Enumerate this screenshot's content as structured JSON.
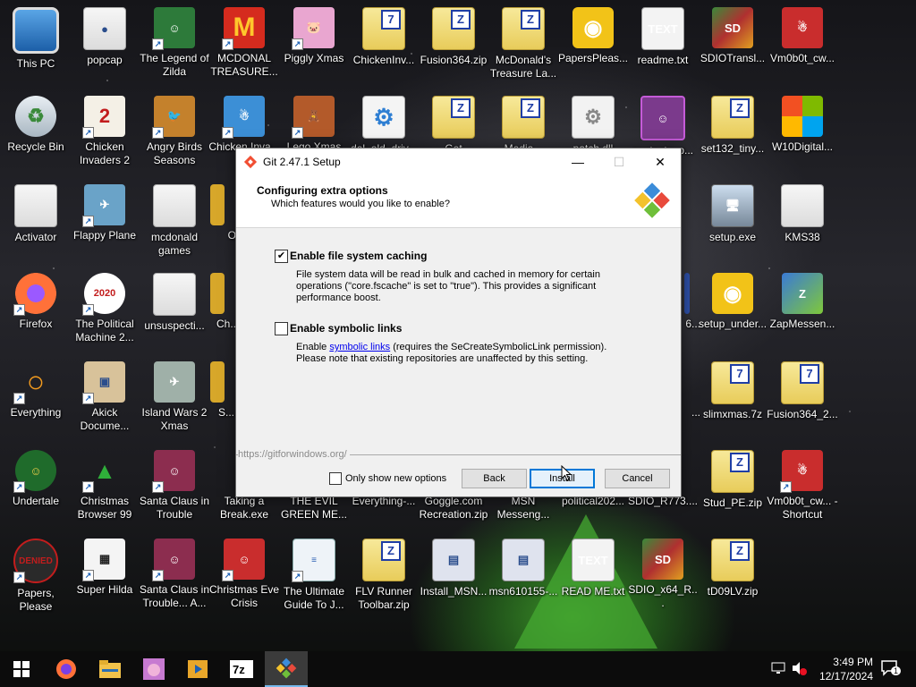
{
  "desktop": {
    "icons": [
      {
        "id": "i0",
        "label": "This PC"
      },
      {
        "id": "i1",
        "label": "popcap"
      },
      {
        "id": "i2",
        "label": "The Legend of Zilda"
      },
      {
        "id": "i3",
        "label": "MCDONAL TREASURE..."
      },
      {
        "id": "i4",
        "label": "Piggly Xmas"
      },
      {
        "id": "i5",
        "label": "ChickenInv..."
      },
      {
        "id": "i6",
        "label": "Fusion364.zip"
      },
      {
        "id": "i7",
        "label": "McDonald's Treasure La..."
      },
      {
        "id": "i8",
        "label": "PapersPleas..."
      },
      {
        "id": "i9",
        "label": "readme.txt"
      },
      {
        "id": "i10",
        "label": "SDIOTransl..."
      },
      {
        "id": "i11",
        "label": "Vm0b0t_cw..."
      },
      {
        "id": "i12",
        "label": "Recycle Bin"
      },
      {
        "id": "i13",
        "label": "Chicken Invaders 2"
      },
      {
        "id": "i14",
        "label": "Angry Birds Seasons"
      },
      {
        "id": "i15",
        "label": "Chicken Inva..."
      },
      {
        "id": "i16",
        "label": "Lego Xmas"
      },
      {
        "id": "i17",
        "label": "del_old_driv..."
      },
      {
        "id": "i18",
        "label": "Get Directions..."
      },
      {
        "id": "i19",
        "label": "Media..."
      },
      {
        "id": "i20",
        "label": "patch.dll"
      },
      {
        "id": "i21",
        "label": "contactsup..."
      },
      {
        "id": "i22",
        "label": "set132_tiny..."
      },
      {
        "id": "i23",
        "label": "W10Digital..."
      },
      {
        "id": "i24",
        "label": "Activator"
      },
      {
        "id": "i25",
        "label": "Flappy Plane"
      },
      {
        "id": "i26",
        "label": "mcdonald games"
      },
      {
        "id": "i27",
        "label": "Orna..."
      },
      {
        "id": "i28",
        "label": "setup.exe"
      },
      {
        "id": "i29",
        "label": "KMS38"
      },
      {
        "id": "i30",
        "label": "Firefox"
      },
      {
        "id": "i31",
        "label": "The Political Machine 2..."
      },
      {
        "id": "i32",
        "label": "unsuspecti..."
      },
      {
        "id": "i33",
        "label": "Ch... Swe..."
      },
      {
        "id": "i34",
        "label": "6..."
      },
      {
        "id": "i35",
        "label": "setup_under..."
      },
      {
        "id": "i36",
        "label": "ZapMessen..."
      },
      {
        "id": "i37",
        "label": "Everything"
      },
      {
        "id": "i38",
        "label": "Akick Docume..."
      },
      {
        "id": "i39",
        "label": "Island Wars 2 Xmas"
      },
      {
        "id": "i40",
        "label": "S... Anim..."
      },
      {
        "id": "i41",
        "label": "..."
      },
      {
        "id": "i42",
        "label": "slimxmas.7z"
      },
      {
        "id": "i43",
        "label": "Fusion364_2..."
      },
      {
        "id": "i44",
        "label": "Undertale"
      },
      {
        "id": "i45",
        "label": "Christmas Browser 99"
      },
      {
        "id": "i46",
        "label": "Santa Claus in Trouble"
      },
      {
        "id": "i47",
        "label": "Taking a Break.exe"
      },
      {
        "id": "i48",
        "label": "THE EVIL GREEN ME..."
      },
      {
        "id": "i49",
        "label": "Everything-..."
      },
      {
        "id": "i50",
        "label": "Goggle.com Recreation.zip"
      },
      {
        "id": "i51",
        "label": "MSN Messeng..."
      },
      {
        "id": "i52",
        "label": "political202..."
      },
      {
        "id": "i53",
        "label": "SDIO_R773...."
      },
      {
        "id": "i54",
        "label": "Stud_PE.zip"
      },
      {
        "id": "i55",
        "label": "Vm0b0t_cw... - Shortcut"
      },
      {
        "id": "i56",
        "label": "Papers, Please"
      },
      {
        "id": "i57",
        "label": "Super Hilda"
      },
      {
        "id": "i58",
        "label": "Santa Claus in Trouble... A..."
      },
      {
        "id": "i59",
        "label": "Christmas Eve Crisis"
      },
      {
        "id": "i60",
        "label": "The Ultimate Guide To J..."
      },
      {
        "id": "i61",
        "label": "FLV Runner Toolbar.zip"
      },
      {
        "id": "i62",
        "label": "Install_MSN..."
      },
      {
        "id": "i63",
        "label": "msn610155-..."
      },
      {
        "id": "i64",
        "label": "READ ME.txt"
      },
      {
        "id": "i65",
        "label": "SDIO_x64_R..."
      },
      {
        "id": "i66",
        "label": "tD09LV.zip"
      }
    ]
  },
  "dialog": {
    "title": "Git 2.47.1 Setup",
    "heading": "Configuring extra options",
    "subheading": "Which features would you like to enable?",
    "options": [
      {
        "label": "Enable file system caching",
        "checked": true,
        "description": "File system data will be read in bulk and cached in memory for certain operations (\"core.fscache\" is set to \"true\"). This provides a significant performance boost."
      },
      {
        "label": "Enable symbolic links",
        "checked": false,
        "desc_pre": "Enable ",
        "desc_link": "symbolic links",
        "desc_post": " (requires the SeCreateSymbolicLink permission). Please note that existing repositories are unaffected by this setting."
      }
    ],
    "footer_url": "https://gitforwindows.org/",
    "only_new_label": "Only show new options",
    "buttons": {
      "back": "Back",
      "install": "Install",
      "cancel": "Cancel"
    },
    "window_controls": {
      "minimize": "—",
      "maximize": "☐",
      "close": "✕"
    }
  },
  "taskbar": {
    "time": "3:49 PM",
    "date": "12/17/2024",
    "notification_count": "1",
    "apps": [
      "start",
      "firefox",
      "file-explorer",
      "piggly",
      "media",
      "7zip",
      "git-setup"
    ]
  }
}
